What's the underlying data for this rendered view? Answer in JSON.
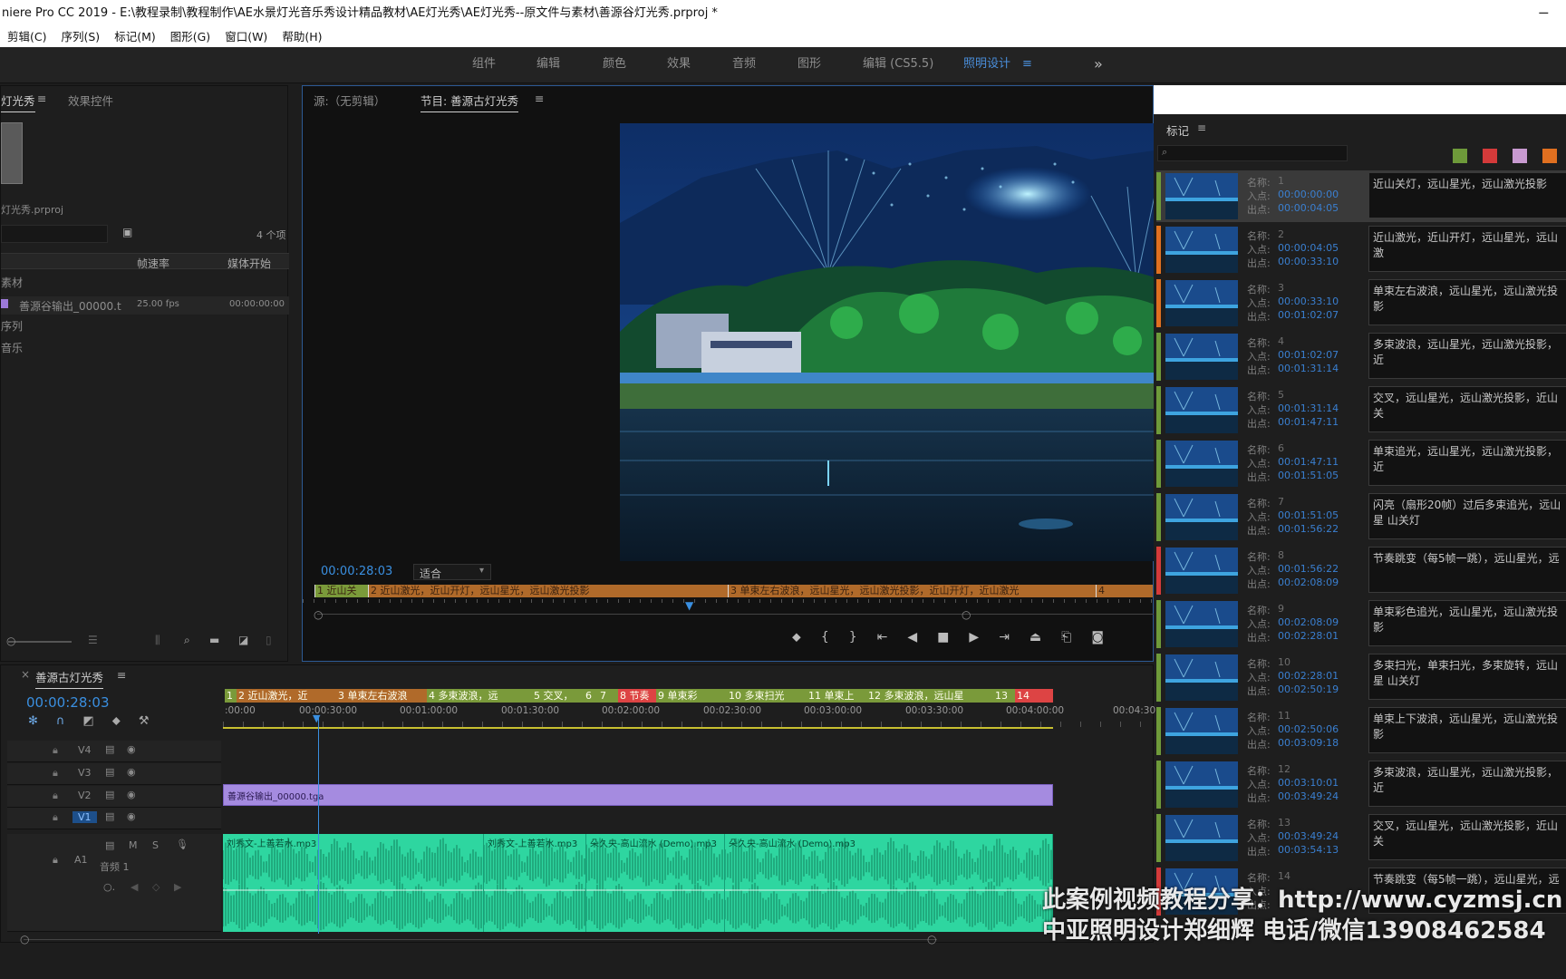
{
  "window": {
    "title": "niere Pro CC 2019 - E:\\教程录制\\教程制作\\AE水景灯光音乐秀设计精品教材\\AE灯光秀\\AE灯光秀--原文件与素材\\善源谷灯光秀.prproj *"
  },
  "menu": [
    "剪辑(C)",
    "序列(S)",
    "标记(M)",
    "图形(G)",
    "窗口(W)",
    "帮助(H)"
  ],
  "workspaces": [
    "组件",
    "编辑",
    "颜色",
    "效果",
    "音频",
    "图形",
    "编辑 (CS5.5)",
    "照明设计"
  ],
  "workspace_active": "照明设计",
  "project": {
    "tab_project": "灯光秀",
    "tab_effects": "效果控件",
    "file": "灯光秀.prproj",
    "item_count": "4 个项",
    "col_fps": "帧速率",
    "col_start": "媒体开始",
    "rows": [
      {
        "name": "素材"
      },
      {
        "name": "善源谷输出_00000.t",
        "fps": "25.00 fps",
        "start": "00:00:00:00"
      },
      {
        "name": "序列"
      },
      {
        "name": "音乐"
      }
    ]
  },
  "program": {
    "source_tab": "源:（无剪辑）",
    "program_tab": "节目: 善源古灯光秀",
    "timecode": "00:00:28:03",
    "fit": "适合",
    "marker_strip": [
      "1 近山关",
      "2 近山激光，近山开灯，远山星光，远山激光投影",
      "3 单束左右波浪，远山星光，远山激光投影，近山开灯，近山激光",
      "4"
    ]
  },
  "markers": {
    "title": "标记",
    "label_name": "名称:",
    "label_in": "入点:",
    "label_out": "出点:",
    "filter_colors": [
      "#6e9a3a",
      "#d43a3a",
      "#c89ad0",
      "#e07020"
    ],
    "items": [
      {
        "num": "1",
        "in": "00:00:00:00",
        "out": "00:00:04:05",
        "color": "#6e9a3a",
        "comment": "近山关灯，远山星光，远山激光投影"
      },
      {
        "num": "2",
        "in": "00:00:04:05",
        "out": "00:00:33:10",
        "color": "#e07020",
        "comment": "近山激光，近山开灯，远山星光，远山激"
      },
      {
        "num": "3",
        "in": "00:00:33:10",
        "out": "00:01:02:07",
        "color": "#e07020",
        "comment": "单束左右波浪，远山星光，远山激光投影"
      },
      {
        "num": "4",
        "in": "00:01:02:07",
        "out": "00:01:31:14",
        "color": "#6e9a3a",
        "comment": "多束波浪，远山星光，远山激光投影，近"
      },
      {
        "num": "5",
        "in": "00:01:31:14",
        "out": "00:01:47:11",
        "color": "#6e9a3a",
        "comment": "交叉，远山星光，远山激光投影，近山关"
      },
      {
        "num": "6",
        "in": "00:01:47:11",
        "out": "00:01:51:05",
        "color": "#6e9a3a",
        "comment": "单束追光，远山星光，远山激光投影，近"
      },
      {
        "num": "7",
        "in": "00:01:51:05",
        "out": "00:01:56:22",
        "color": "#6e9a3a",
        "comment": "闪亮（扇形20帧）过后多束追光，远山星 山关灯"
      },
      {
        "num": "8",
        "in": "00:01:56:22",
        "out": "00:02:08:09",
        "color": "#d43a3a",
        "comment": "节奏跳变（每5帧一跳），远山星光，远"
      },
      {
        "num": "9",
        "in": "00:02:08:09",
        "out": "00:02:28:01",
        "color": "#6e9a3a",
        "comment": "单束彩色追光，远山星光，远山激光投影"
      },
      {
        "num": "10",
        "in": "00:02:28:01",
        "out": "00:02:50:19",
        "color": "#6e9a3a",
        "comment": "多束扫光，单束扫光，多束旋转，远山星 山关灯"
      },
      {
        "num": "11",
        "in": "00:02:50:06",
        "out": "00:03:09:18",
        "color": "#6e9a3a",
        "comment": "单束上下波浪，远山星光，远山激光投影"
      },
      {
        "num": "12",
        "in": "00:03:10:01",
        "out": "00:03:49:24",
        "color": "#6e9a3a",
        "comment": "多束波浪，远山星光，远山激光投影，近"
      },
      {
        "num": "13",
        "in": "00:03:49:24",
        "out": "00:03:54:13",
        "color": "#6e9a3a",
        "comment": "交叉，远山星光，远山激光投影，近山关"
      },
      {
        "num": "14",
        "in": "",
        "out": "",
        "color": "#d43a3a",
        "comment": "节奏跳变（每5帧一跳），远山星光，远"
      }
    ]
  },
  "timeline": {
    "sequence_tab": "善源古灯光秀",
    "timecode": "00:00:28:03",
    "ruler": [
      ":00:00",
      "00:00:30:00",
      "00:01:00:00",
      "00:01:30:00",
      "00:02:00:00",
      "00:02:30:00",
      "00:03:00:00",
      "00:03:30:00",
      "00:04:00:00",
      "00:04:30"
    ],
    "marker_labels": [
      "1",
      "2 近山激光，近",
      "3 单束左右波浪",
      "4 多束波浪，远",
      "5 交叉，",
      "6",
      "7",
      "8 节奏",
      "9 单束彩",
      "10 多束扫光",
      "11 单束上",
      "12 多束波浪，远山星",
      "13",
      "14"
    ],
    "tracks": {
      "v4": "V4",
      "v3": "V3",
      "v2": "V2",
      "v1": "V1",
      "a1": "A1",
      "a1_name": "音频 1",
      "m": "M",
      "s": "S"
    },
    "video_clip": "善源谷输出_00000.tga",
    "audio_clips": [
      "刘秀文-上善若水.mp3",
      "刘秀文-上善若水.mp3",
      "朵久央-高山流水 (Demo).mp3",
      "朵久央-高山流水 (Demo).mp3"
    ]
  },
  "watermark": {
    "line1": "此案例视频教程分享：http://www.cyzmsj.cn",
    "line2": "中亚照明设计郑细辉 电话/微信13908462584"
  }
}
